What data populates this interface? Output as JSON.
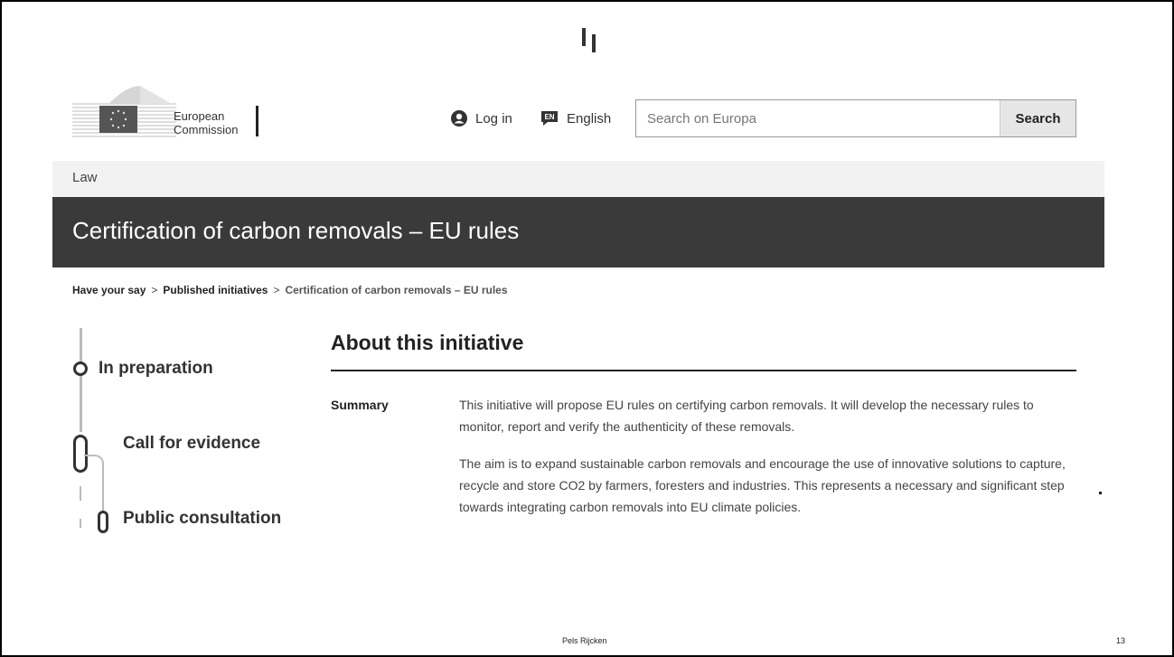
{
  "header": {
    "logo_line1": "European",
    "logo_line2": "Commission",
    "login_label": "Log in",
    "language_code": "EN",
    "language_label": "English",
    "search_placeholder": "Search on Europa",
    "search_button": "Search"
  },
  "section_label": "Law",
  "page_title": "Certification of carbon removals – EU rules",
  "breadcrumb": {
    "items": [
      "Have your say",
      "Published initiatives"
    ],
    "separator": ">",
    "current": "Certification of carbon removals – EU rules"
  },
  "timeline": {
    "stages": [
      "In preparation",
      "Call for evidence",
      "Public consultation"
    ]
  },
  "about": {
    "heading": "About this initiative",
    "summary_label": "Summary",
    "paragraph1": "This initiative will propose EU rules on certifying carbon removals. It will develop the necessary rules to monitor, report and verify the authenticity of these removals.",
    "paragraph2": "The aim is to expand sustainable carbon removals and encourage the use of innovative solutions to capture, recycle and store CO2 by farmers, foresters and industries. This represents a necessary and significant step towards integrating carbon removals into EU climate policies."
  },
  "footer": {
    "text": "Pels Rijcken",
    "page_number": "13"
  },
  "colors": {
    "title_bar_bg": "#3a3a3a",
    "law_bar_bg": "#f2f2f2",
    "search_button_bg": "#e6e6e6"
  }
}
